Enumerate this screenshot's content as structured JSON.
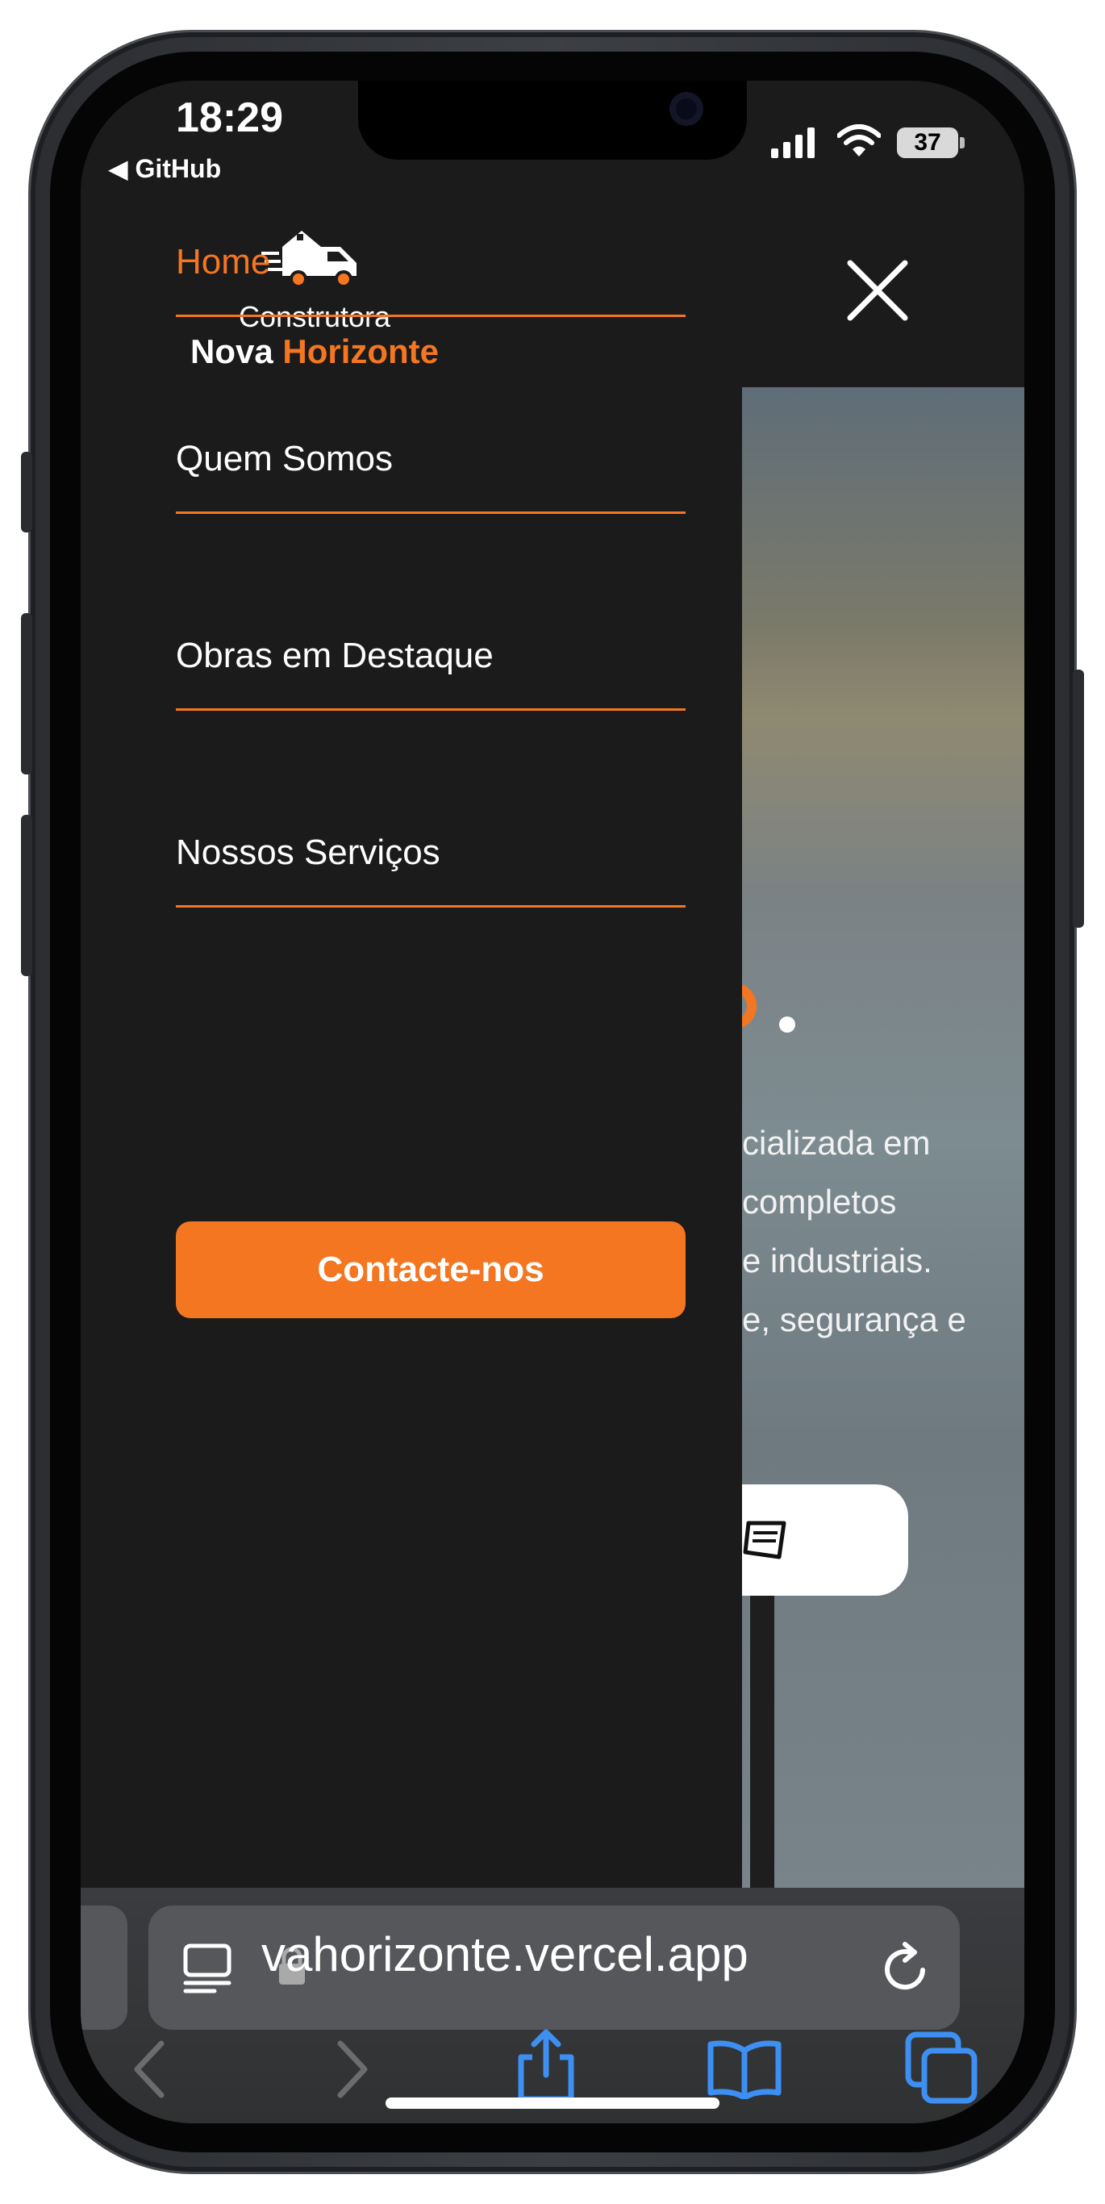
{
  "status_bar": {
    "time": "18:29",
    "back_label": "GitHub",
    "battery": "37",
    "icons": [
      "cellular-signal-icon",
      "wifi-icon",
      "battery-icon"
    ]
  },
  "logo": {
    "line1": "Construtora",
    "line2_main": "Nova",
    "line2_accent": "Horizonte",
    "icon": "truck-house-icon"
  },
  "menu": {
    "close_icon": "close-icon",
    "items": [
      {
        "label": "Home",
        "active": true
      },
      {
        "label": "Quem Somos",
        "active": false
      },
      {
        "label": "Obras em Destaque",
        "active": false
      },
      {
        "label": "Nossos Serviços",
        "active": false
      }
    ],
    "cta_label": "Contacte-nos"
  },
  "hero_partial": {
    "lines": [
      "cializada em",
      "completos",
      "e industriais.",
      "e, segurança e"
    ]
  },
  "browser": {
    "url": "vahorizonte.vercel.app",
    "icons": [
      "reader-icon",
      "lock-icon",
      "reload-icon",
      "back-icon",
      "forward-icon",
      "share-icon",
      "bookmarks-icon",
      "tabs-icon"
    ]
  },
  "colors": {
    "accent": "#f47621",
    "drawer_bg": "#1b1b1b",
    "text": "#ffffff"
  }
}
